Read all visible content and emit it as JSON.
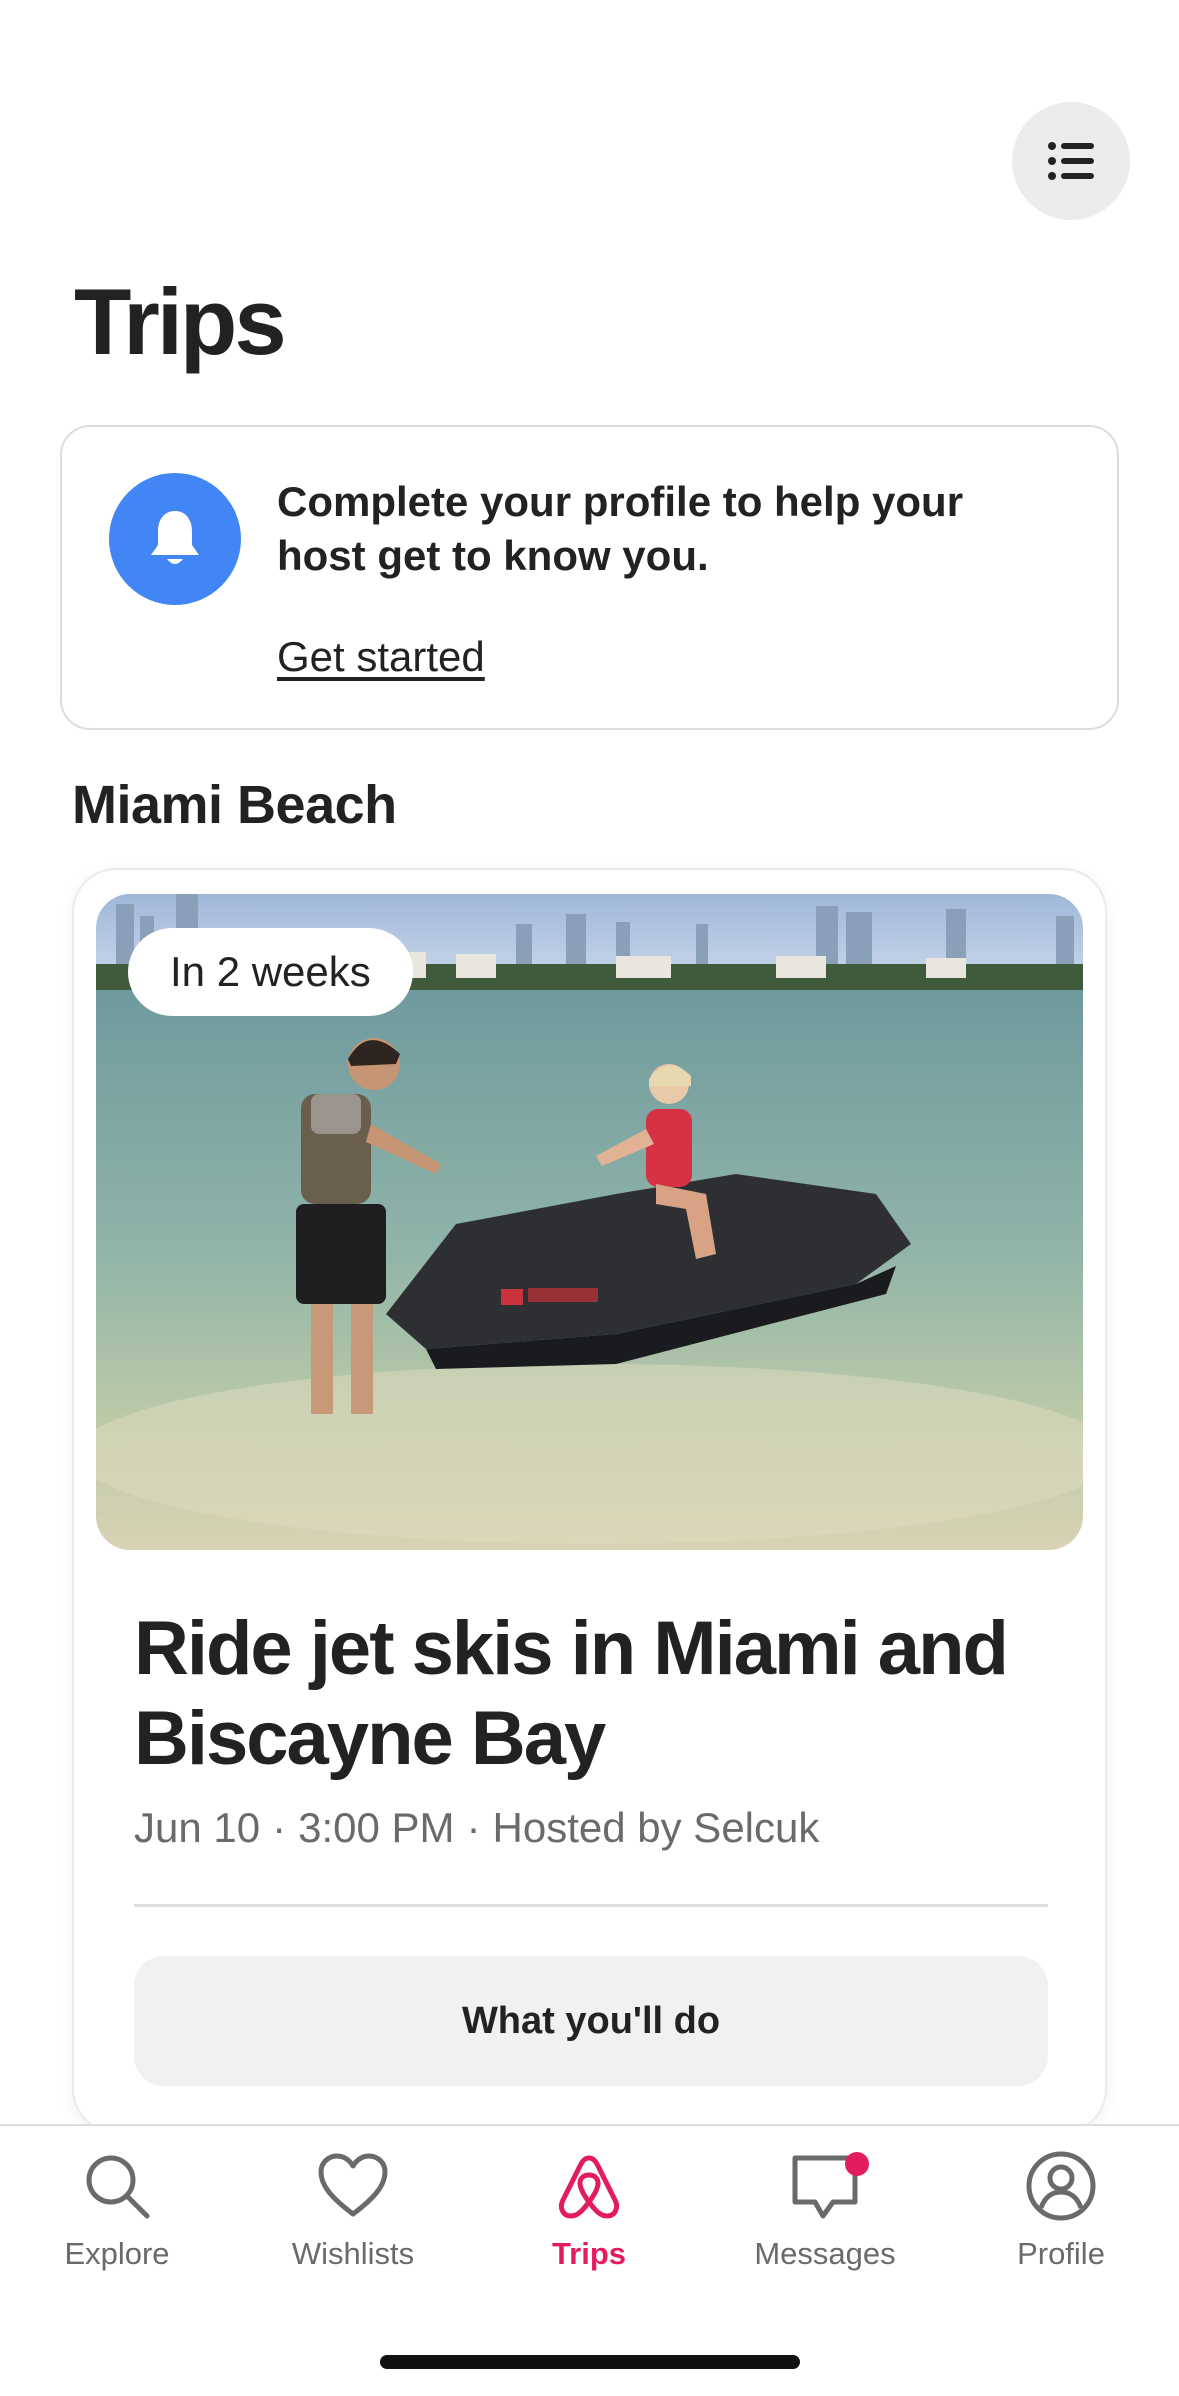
{
  "header": {
    "title": "Trips",
    "menu_icon": "list-icon"
  },
  "notice": {
    "icon": "bell-icon",
    "icon_color": "#4285f4",
    "text": "Complete your profile to help your host get to know you.",
    "link": "Get started"
  },
  "section": {
    "title": "Miami Beach"
  },
  "trip": {
    "badge": "In 2 weeks",
    "title": "Ride jet skis in Miami and Biscayne Bay",
    "date": "Jun 10",
    "time": "3:00 PM",
    "host": "Hosted by Selcuk",
    "action": "What you'll do"
  },
  "tabbar": {
    "accent_color": "#e31c5f",
    "tabs": [
      {
        "label": "Explore",
        "icon": "search-icon",
        "active": false
      },
      {
        "label": "Wishlists",
        "icon": "heart-icon",
        "active": false
      },
      {
        "label": "Trips",
        "icon": "airbnb-logo-icon",
        "active": true
      },
      {
        "label": "Messages",
        "icon": "message-icon",
        "active": false,
        "has_notification": true
      },
      {
        "label": "Profile",
        "icon": "profile-icon",
        "active": false
      }
    ]
  }
}
